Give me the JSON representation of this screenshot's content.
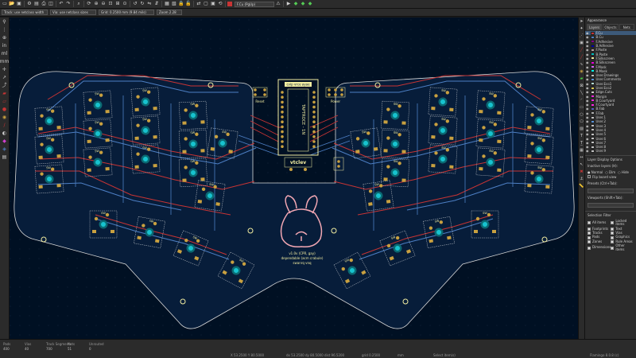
{
  "toolbar": {
    "track_width": "Track: use netclass width",
    "via_size": "Via: use netclass sizes",
    "grid": "Grid: 0.2500 mm (9.84 mils)",
    "zoom": "Zoom 2.28",
    "active_layer": "F.Cu (PgUp)"
  },
  "appearance": {
    "title": "Appearance",
    "tabs": [
      "Layers",
      "Objects",
      "Nets"
    ],
    "layers": [
      {
        "name": "F.Cu",
        "color": "#c83434"
      },
      {
        "name": "B.Cu",
        "color": "#4d7fc4"
      },
      {
        "name": "F.Adhesive",
        "color": "#84008a"
      },
      {
        "name": "B.Adhesive",
        "color": "#0000a8"
      },
      {
        "name": "F.Paste",
        "color": "#b4a0a0"
      },
      {
        "name": "B.Paste",
        "color": "#00c2c2"
      },
      {
        "name": "F.Silkscreen",
        "color": "#f2eda1"
      },
      {
        "name": "B.Silkscreen",
        "color": "#e800d9"
      },
      {
        "name": "F.Mask",
        "color": "#d864ff"
      },
      {
        "name": "B.Mask",
        "color": "#02ffee"
      },
      {
        "name": "User.Drawings",
        "color": "#c2c2c2"
      },
      {
        "name": "User.Comments",
        "color": "#5994dc"
      },
      {
        "name": "User.Eco1",
        "color": "#b4db d2"
      },
      {
        "name": "User.Eco2",
        "color": "#d8c852"
      },
      {
        "name": "Edge.Cuts",
        "color": "#d0d2cd"
      },
      {
        "name": "Margin",
        "color": "#ff26e2"
      },
      {
        "name": "B.Courtyard",
        "color": "#ff26e2"
      },
      {
        "name": "F.Courtyard",
        "color": "#ff26e2"
      },
      {
        "name": "B.Fab",
        "color": "#585dc4"
      },
      {
        "name": "F.Fab",
        "color": "#afafaf"
      },
      {
        "name": "User.1",
        "color": "#c2c2c2"
      },
      {
        "name": "User.2",
        "color": "#5994dc"
      },
      {
        "name": "User.3",
        "color": "#c2c2c2"
      },
      {
        "name": "User.4",
        "color": "#c2c2c2"
      },
      {
        "name": "User.5",
        "color": "#c2c2c2"
      },
      {
        "name": "User.6",
        "color": "#c2c2c2"
      },
      {
        "name": "User.7",
        "color": "#c2c2c2"
      },
      {
        "name": "User.8",
        "color": "#c2c2c2"
      },
      {
        "name": "User.9",
        "color": "#c2c2c2"
      }
    ],
    "active_layer_index": 0,
    "display_options": "Layer Display Options",
    "inactive_layers": "Inactive layers (H):",
    "inactive_opts": [
      "Normal",
      "Dim",
      "Hide"
    ],
    "flip": "Flip board view",
    "presets": "Presets (Ctrl+Tab):",
    "viewports": "Viewports (Shift+Tab):"
  },
  "selection_filter": {
    "title": "Selection Filter",
    "items": [
      "All items",
      "Locked items",
      "Footprints",
      "Text",
      "Tracks",
      "Vias",
      "Pads",
      "Graphics",
      "Zones",
      "Rule Areas",
      "Dimensions",
      "Other items"
    ]
  },
  "board": {
    "mcu_header": "cvip vrce ayae",
    "mcu_label": "TAPTROCE - 1N",
    "reset_label": "Reset",
    "power_label": "Power",
    "brand": "vtclev",
    "credit_1": "v1.0v (CPR, gay)",
    "credit_2": "dependable (acm crabule)",
    "credit_3": "swanrq vnq",
    "key_label": "SW"
  },
  "status": {
    "labels": [
      "Pads",
      "Vias",
      "Track Segments",
      "Nets",
      "Unrouted"
    ],
    "values": [
      "400",
      "40",
      "700",
      "51",
      "0"
    ],
    "coords": "X 53.2500  Y 80.5000",
    "delta": "dx 53.2500  dy 80.5000  dist 96.5200",
    "grid": "grid 0.2500",
    "units": "mm",
    "mode": "Select item(s)",
    "file": "Flamingo 8.0.8 (c)"
  }
}
